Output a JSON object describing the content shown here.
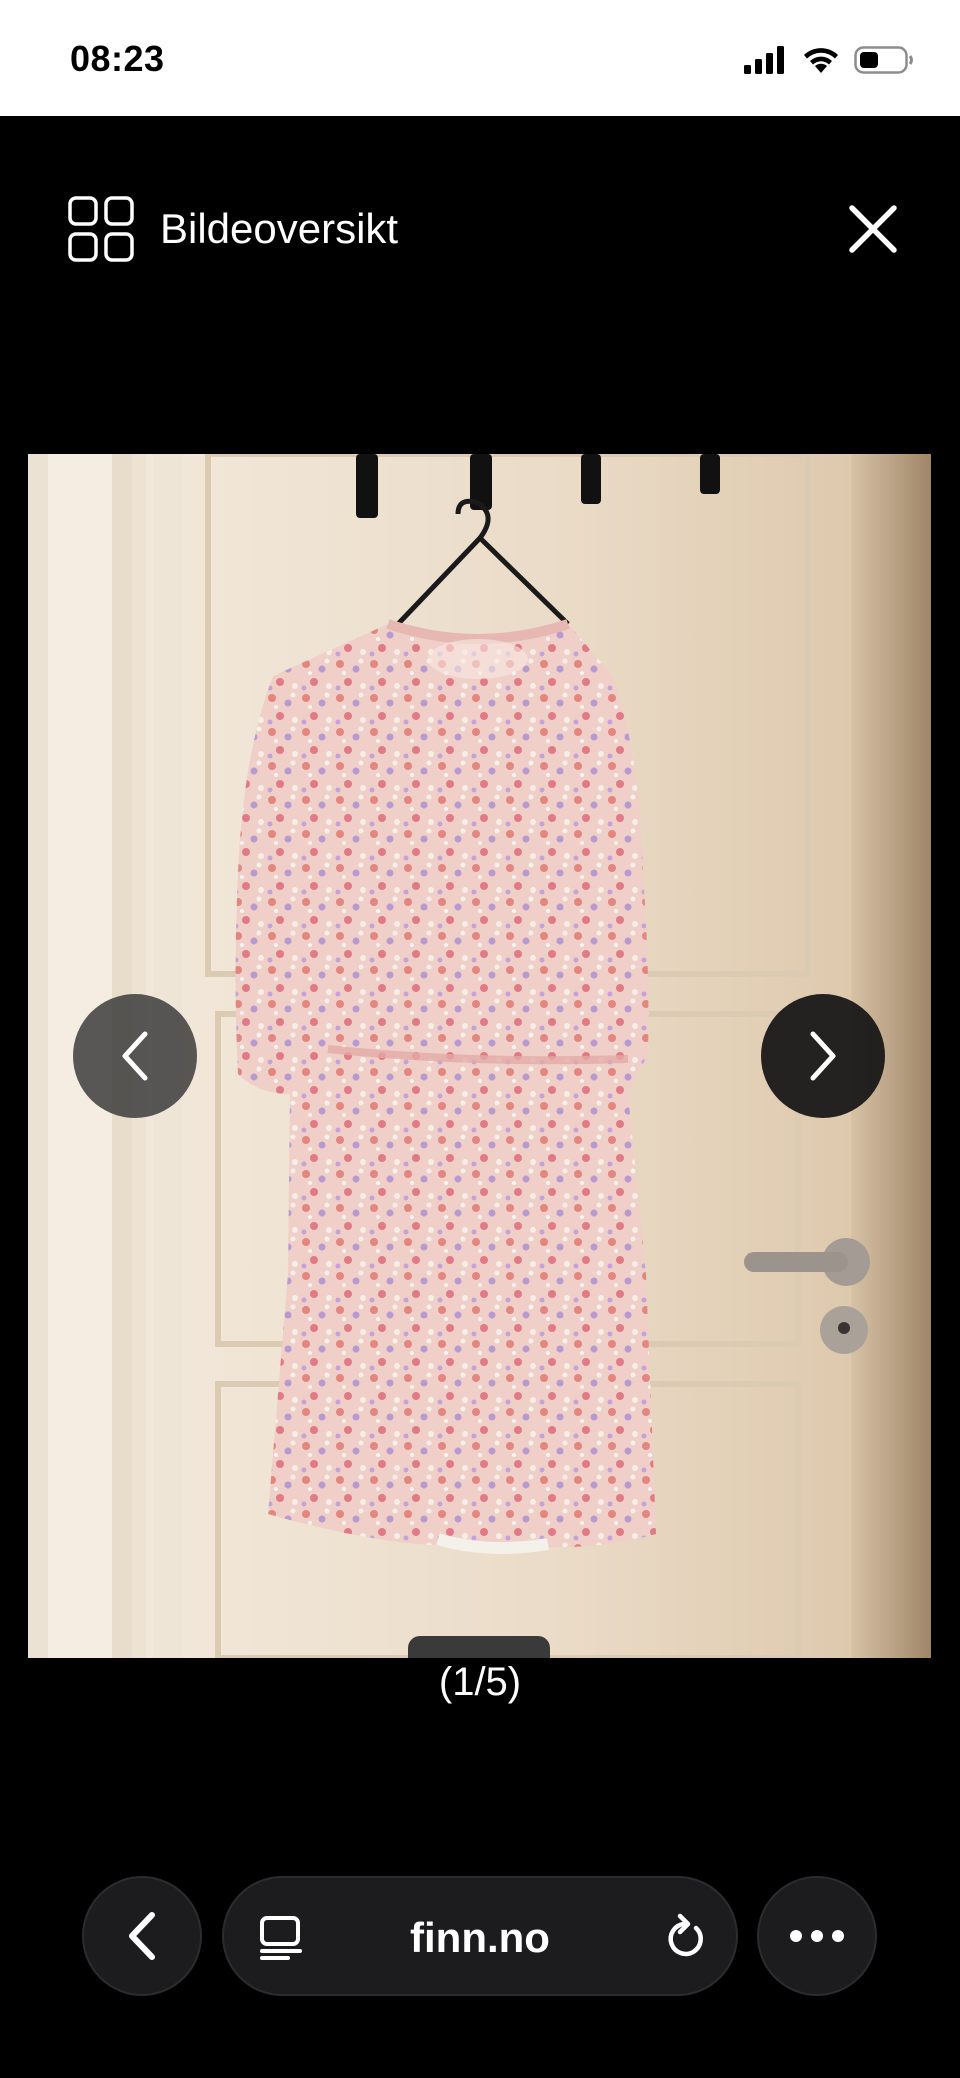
{
  "status_bar": {
    "time": "08:23",
    "icons": [
      "cellular-signal-icon",
      "wifi-icon",
      "battery-icon"
    ]
  },
  "header": {
    "overview_label": "Bildeoversikt",
    "overview_icon": "grid-icon",
    "close_icon": "close-icon"
  },
  "viewer": {
    "photo_subject": "floral-dress-on-hanger",
    "prev_icon": "chevron-left-icon",
    "next_icon": "chevron-right-icon",
    "counter": "(1/5)"
  },
  "browser": {
    "url": "finn.no",
    "back_icon": "chevron-left-icon",
    "reader_icon": "reader-mode-icon",
    "reload_icon": "reload-icon",
    "more_icon": "more-icon"
  },
  "colors": {
    "background": "#000000",
    "status_bar_bg": "#FFFFFF",
    "toolbar_button_bg": "#1C1C1E",
    "door": "#EDE0CF",
    "dress": "#E9C3BC"
  }
}
